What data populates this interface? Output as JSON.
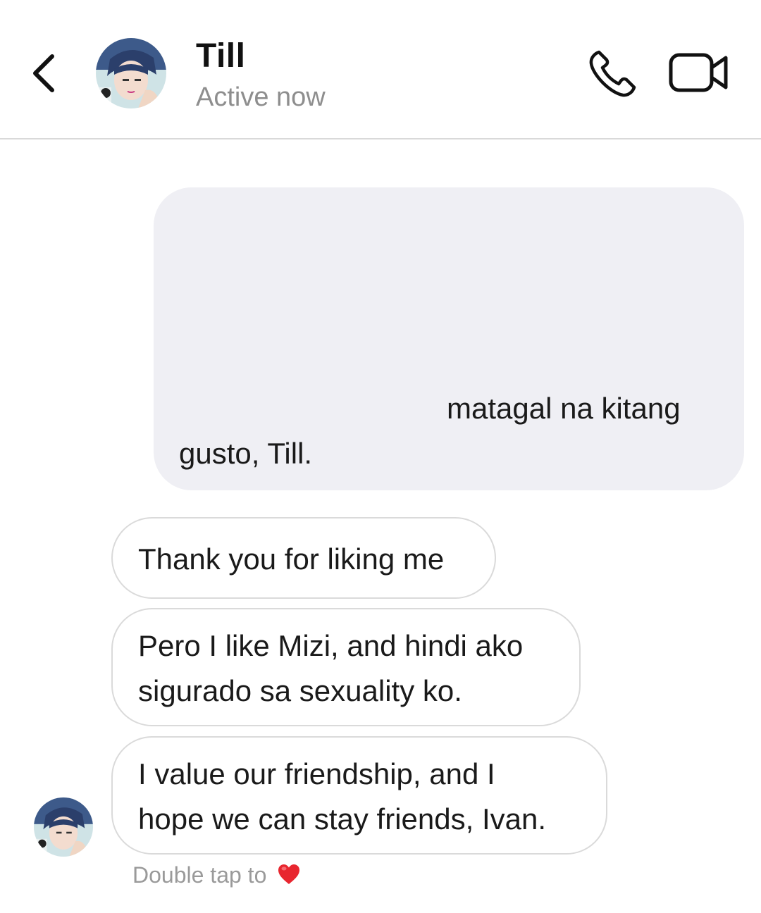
{
  "header": {
    "contact_name": "Till",
    "status": "Active now",
    "back_icon": "chevron-left-icon",
    "call_icon": "phone-icon",
    "video_icon": "video-camera-icon"
  },
  "messages": [
    {
      "direction": "outgoing",
      "text": "matagal na kitang gusto, Till."
    },
    {
      "direction": "incoming",
      "lines": [
        "Thank you for liking me"
      ]
    },
    {
      "direction": "incoming",
      "lines": [
        "Pero I like Mizi, and hindi ako",
        "sigurado sa sexuality ko."
      ]
    },
    {
      "direction": "incoming",
      "lines": [
        "I value our friendship, and I",
        "hope we can stay friends, Ivan."
      ]
    }
  ],
  "footer": {
    "hint_text": "Double tap to",
    "hint_icon": "heart-icon",
    "heart_color": "#e8262f"
  },
  "colors": {
    "outgoing_bubble": "#efeff4",
    "incoming_border": "#dadada",
    "status_text": "#8e8e8e"
  }
}
